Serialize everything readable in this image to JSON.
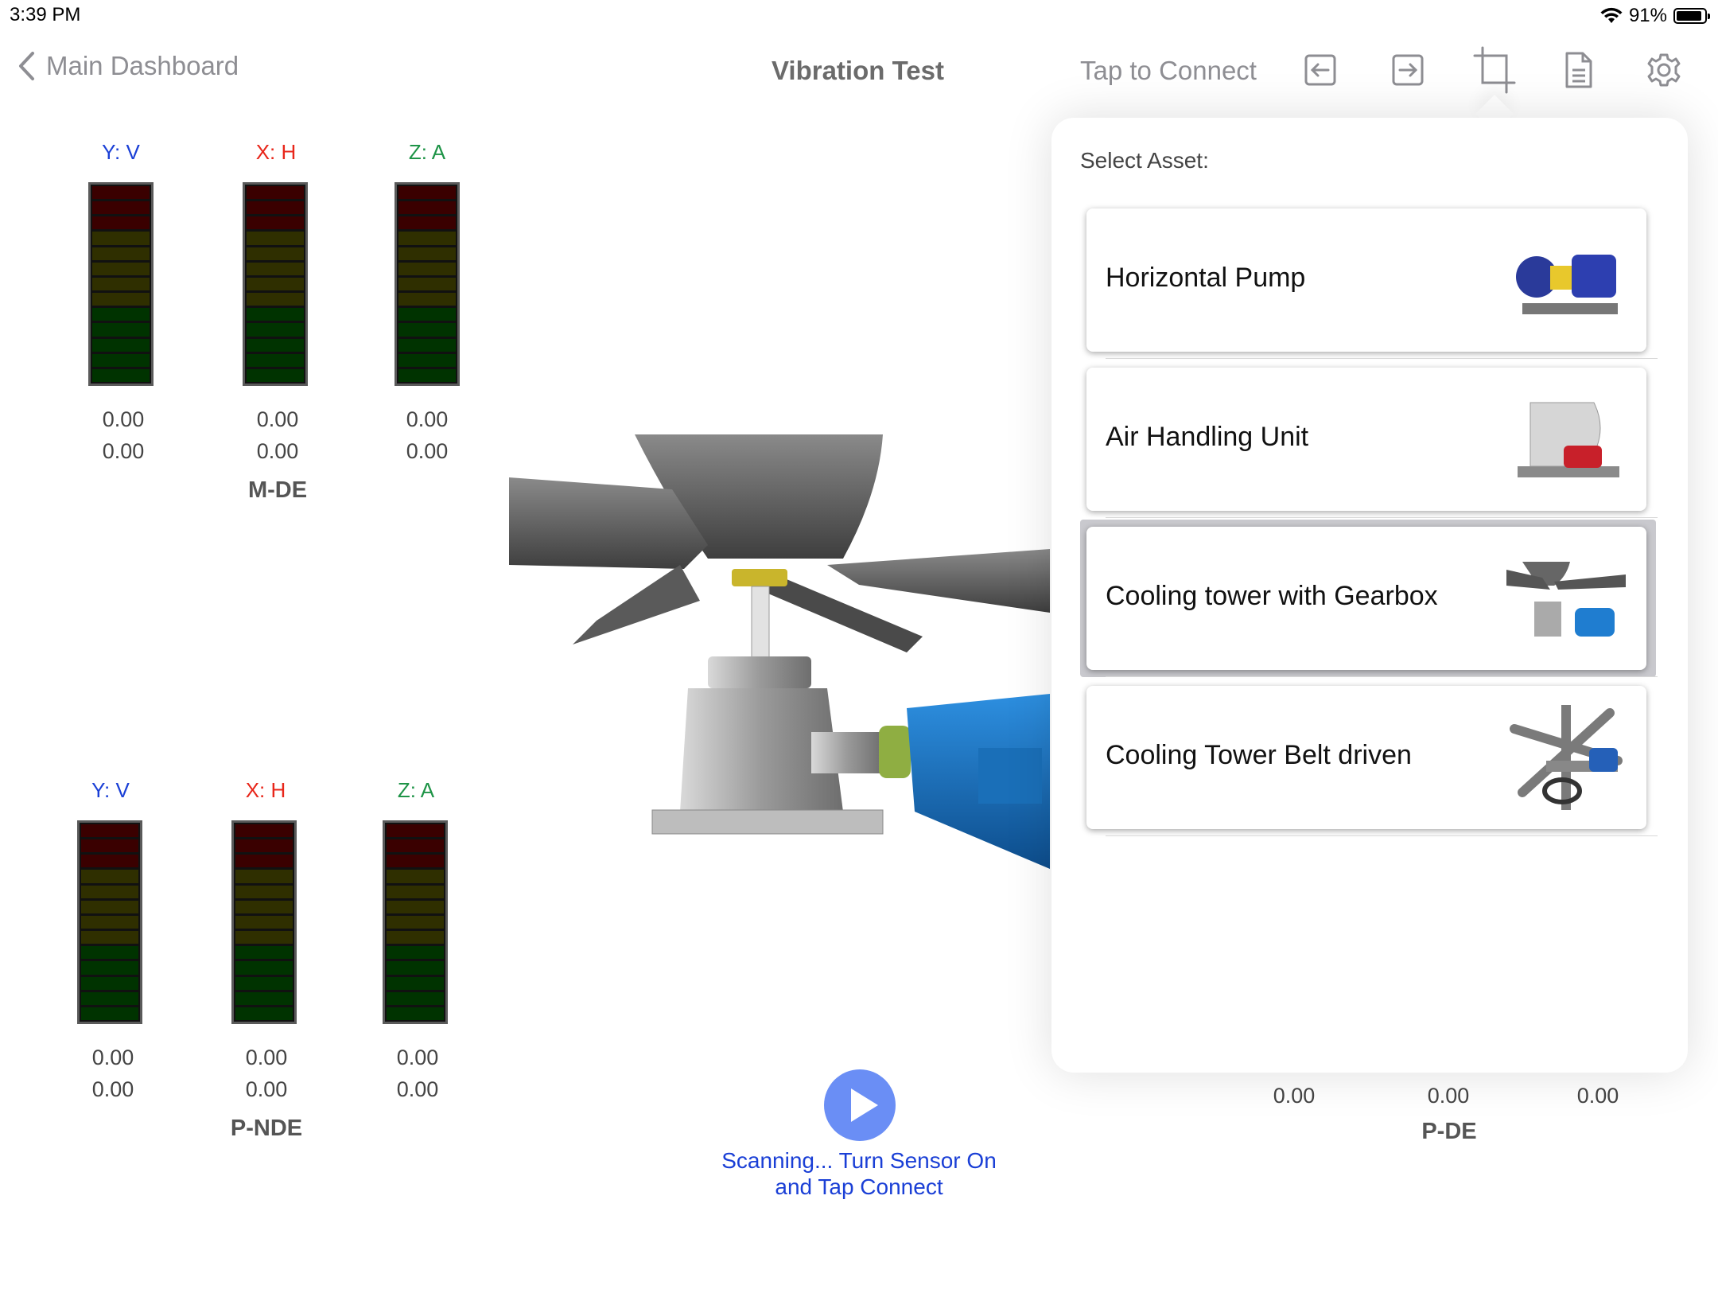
{
  "status_bar": {
    "time": "3:39 PM",
    "battery": "91%",
    "battery_level": 0.91
  },
  "nav": {
    "back_label": "Main Dashboard",
    "title": "Vibration Test",
    "connect_label": "Tap to Connect"
  },
  "axes": {
    "y": "Y: V",
    "x": "X: H",
    "z": "Z: A"
  },
  "colors": {
    "y_axis": "#1a3fd6",
    "x_axis": "#e8261a",
    "z_axis": "#1e9447",
    "accent": "#6a8ef5"
  },
  "m_de": {
    "label": "M-DE",
    "y": [
      "0.00",
      "0.00"
    ],
    "x": [
      "0.00",
      "0.00"
    ],
    "z": [
      "0.00",
      "0.00"
    ]
  },
  "p_nde": {
    "label": "P-NDE",
    "y": [
      "0.00",
      "0.00"
    ],
    "x": [
      "0.00",
      "0.00"
    ],
    "z": [
      "0.00",
      "0.00"
    ]
  },
  "p_de": {
    "label": "P-DE",
    "values": [
      "0.00",
      "0.00",
      "0.00"
    ]
  },
  "scan": {
    "line1": "Scanning... Turn Sensor On",
    "line2": "and Tap Connect"
  },
  "popover": {
    "title": "Select Asset:",
    "assets": [
      {
        "name": "Horizontal Pump",
        "icon": "horizontal-pump-icon"
      },
      {
        "name": "Air Handling Unit",
        "icon": "air-handling-unit-icon"
      },
      {
        "name": "Cooling tower with Gearbox",
        "icon": "cooling-tower-gearbox-icon",
        "selected": true
      },
      {
        "name": "Cooling Tower Belt driven",
        "icon": "cooling-tower-belt-icon"
      }
    ]
  }
}
